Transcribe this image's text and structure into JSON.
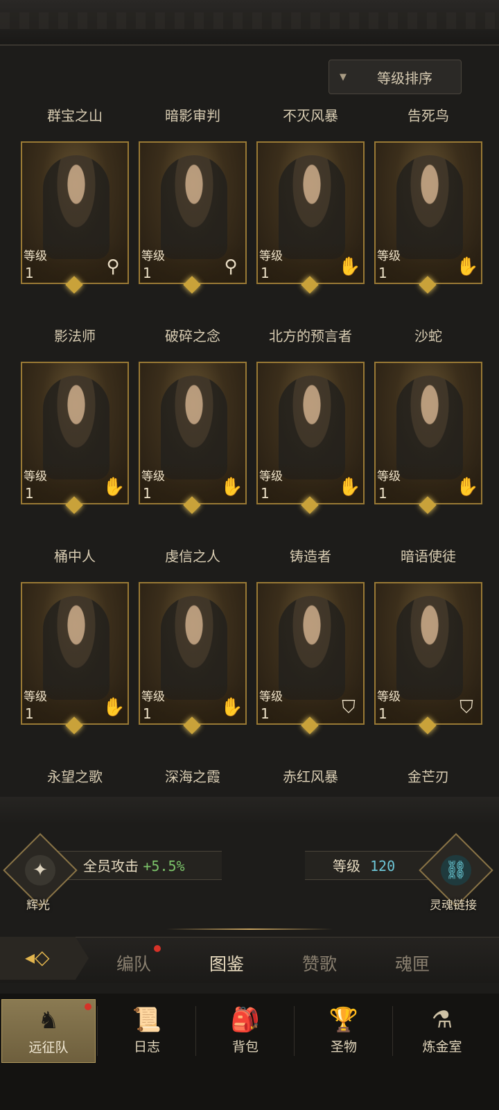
{
  "sort_button": {
    "label": "等级排序"
  },
  "cards": [
    {
      "name": "群宝之山",
      "level_label": "等级",
      "level": "1",
      "class_icon": "staff-icon"
    },
    {
      "name": "暗影审判",
      "level_label": "等级",
      "level": "1",
      "class_icon": "staff-icon"
    },
    {
      "name": "不灭风暴",
      "level_label": "等级",
      "level": "1",
      "class_icon": "palm-icon"
    },
    {
      "name": "告死鸟",
      "level_label": "等级",
      "level": "1",
      "class_icon": "palm-icon"
    },
    {
      "name": "影法师",
      "level_label": "等级",
      "level": "1",
      "class_icon": "palm-icon"
    },
    {
      "name": "破碎之念",
      "level_label": "等级",
      "level": "1",
      "class_icon": "palm-icon"
    },
    {
      "name": "北方的预言者",
      "level_label": "等级",
      "level": "1",
      "class_icon": "palm-icon"
    },
    {
      "name": "沙蛇",
      "level_label": "等级",
      "level": "1",
      "class_icon": "palm-icon"
    },
    {
      "name": "桶中人",
      "level_label": "等级",
      "level": "1",
      "class_icon": "palm-icon"
    },
    {
      "name": "虔信之人",
      "level_label": "等级",
      "level": "1",
      "class_icon": "palm-icon"
    },
    {
      "name": "铸造者",
      "level_label": "等级",
      "level": "1",
      "class_icon": "shield-icon"
    },
    {
      "name": "暗语使徒",
      "level_label": "等级",
      "level": "1",
      "class_icon": "shield-icon"
    },
    {
      "name": "永望之歌"
    },
    {
      "name": "深海之霞"
    },
    {
      "name": "赤红风暴"
    },
    {
      "name": "金芒刃"
    }
  ],
  "bonus": {
    "left_emblem_label": "辉光",
    "left_text": "全员攻击",
    "left_value": "+5.5%",
    "right_text": "等级",
    "right_value": "120",
    "right_emblem_label": "灵魂链接"
  },
  "tabs": [
    {
      "label": "编队",
      "badge": true
    },
    {
      "label": "图鉴",
      "active": true
    },
    {
      "label": "赞歌"
    },
    {
      "label": "魂匣"
    }
  ],
  "nav": [
    {
      "label": "远征队",
      "icon": "horned-helmet-icon",
      "active": true,
      "badge": true
    },
    {
      "label": "日志",
      "icon": "scroll-icon"
    },
    {
      "label": "背包",
      "icon": "bag-icon"
    },
    {
      "label": "圣物",
      "icon": "chalice-icon"
    },
    {
      "label": "炼金室",
      "icon": "alchemy-icon"
    }
  ]
}
